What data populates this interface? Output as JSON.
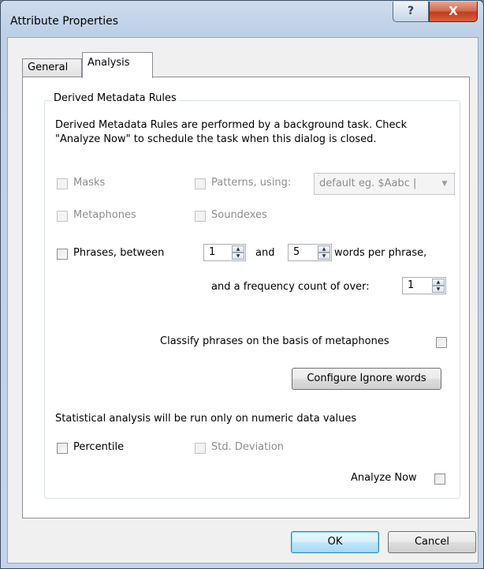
{
  "window": {
    "title": "Attribute Properties",
    "help_label": "?",
    "close_label": "X"
  },
  "tabs": [
    {
      "label": "General",
      "selected": false
    },
    {
      "label": "Analysis",
      "selected": true
    }
  ],
  "group": {
    "label": "Derived Metadata Rules",
    "description_line1": "Derived Metadata Rules are performed by a background task. Check",
    "description_line2": "\"Analyze Now\" to schedule the task when this dialog is closed."
  },
  "options": {
    "masks_label": "Masks",
    "patterns_label": "Patterns, using:",
    "patterns_combo_value": "default eg. $Aabc |",
    "metaphones_label": "Metaphones",
    "soundexes_label": "Soundexes",
    "phrases_label": "Phrases, between",
    "phrases_min": "1",
    "and_label": "and",
    "phrases_max": "5",
    "words_per_phrase_label": "words per phrase,",
    "frequency_label": "and a frequency count of over:",
    "frequency_value": "1",
    "classify_label": "Classify phrases on the basis of metaphones",
    "configure_button": "Configure Ignore words",
    "statistical_note": "Statistical analysis will be run only on numeric data values",
    "percentile_label": "Percentile",
    "std_dev_label": "Std. Deviation",
    "analyze_now_label": "Analyze Now"
  },
  "buttons": {
    "ok": "OK",
    "cancel": "Cancel"
  }
}
